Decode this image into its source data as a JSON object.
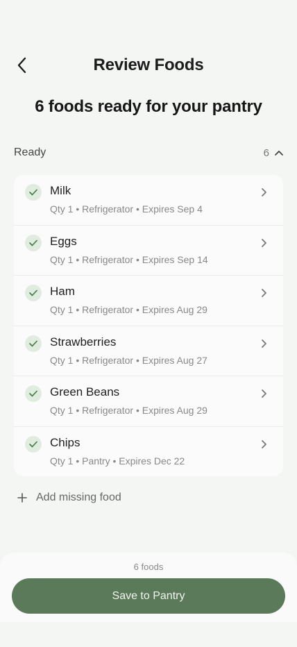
{
  "header": {
    "title": "Review Foods"
  },
  "headline": "6 foods ready for your pantry",
  "section": {
    "title": "Ready",
    "count": "6"
  },
  "items": [
    {
      "name": "Milk",
      "meta": "Qty 1 • Refrigerator • Expires Sep 4"
    },
    {
      "name": "Eggs",
      "meta": "Qty 1 • Refrigerator • Expires Sep 14"
    },
    {
      "name": "Ham",
      "meta": "Qty 1 • Refrigerator • Expires Aug 29"
    },
    {
      "name": "Strawberries",
      "meta": "Qty 1 • Refrigerator • Expires Aug 27"
    },
    {
      "name": "Green Beans",
      "meta": "Qty 1 • Refrigerator • Expires Aug 29"
    },
    {
      "name": "Chips",
      "meta": "Qty 1 • Pantry • Expires Dec 22"
    }
  ],
  "add_missing": {
    "label": "Add missing food"
  },
  "footer": {
    "count_label": "6 foods",
    "save_label": "Save to Pantry"
  },
  "colors": {
    "accent": "#5b7a59",
    "check_bg": "#e1ece0",
    "background": "#f4f6f4"
  },
  "icons": {
    "back": "chevron-left-icon",
    "collapse": "chevron-up-icon",
    "check": "check-icon",
    "row": "chevron-right-icon",
    "add": "plus-icon"
  }
}
